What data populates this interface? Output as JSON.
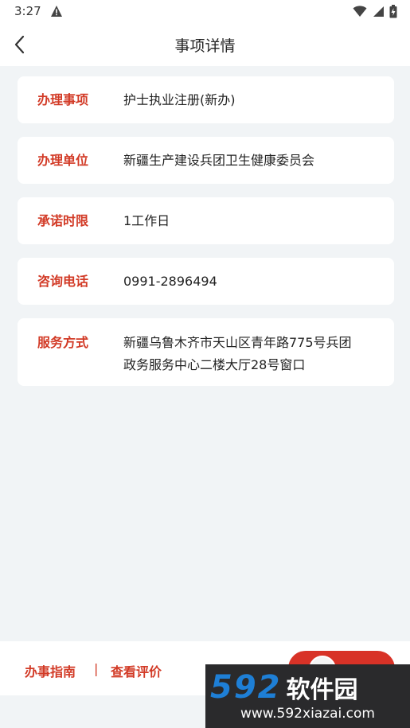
{
  "status_bar": {
    "time": "3:27"
  },
  "nav": {
    "title": "事项详情"
  },
  "details": [
    {
      "label": "办理事项",
      "value": "护士执业注册(新办)"
    },
    {
      "label": "办理单位",
      "value": "新疆生产建设兵团卫生健康委员会"
    },
    {
      "label": "承诺时限",
      "value": "1工作日"
    },
    {
      "label": "咨询电话",
      "value": "0991-2896494"
    },
    {
      "label": "服务方式",
      "value_line1": "新疆乌鲁木齐市天山区青年路775号兵团",
      "value_line2": "政务服务中心二楼大厅28号窗口"
    }
  ],
  "bottom": {
    "guide": "办事指南",
    "separator": "|",
    "review": "查看评价"
  },
  "watermark": {
    "number": "592",
    "name": "软件园",
    "url": "www.592xiazai.com"
  },
  "colors": {
    "accent": "#d23a26",
    "background": "#f1f4f6",
    "card": "#ffffff"
  }
}
